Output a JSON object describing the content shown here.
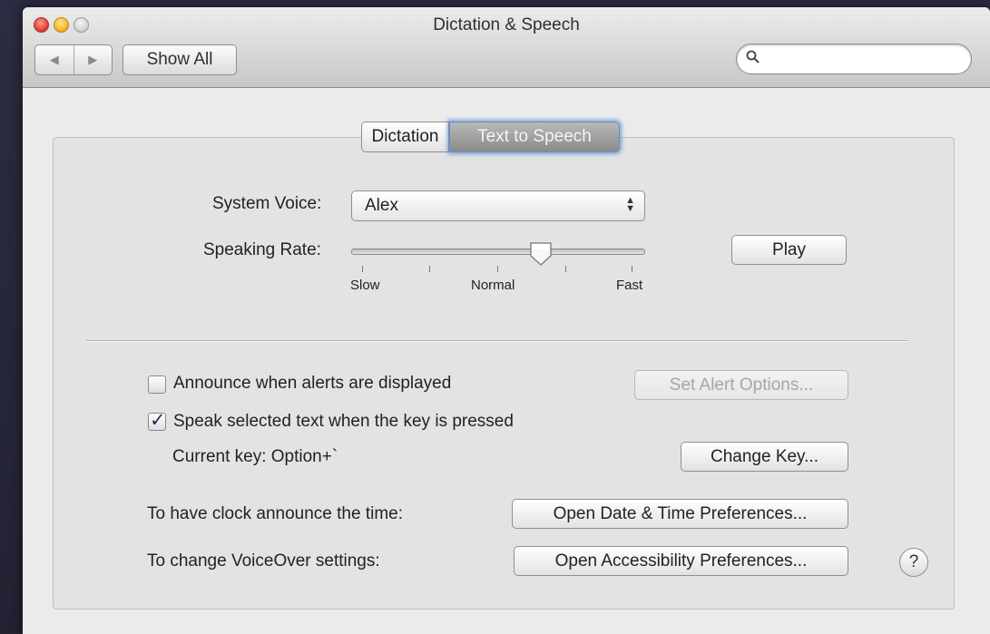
{
  "window": {
    "title": "Dictation & Speech",
    "show_all_label": "Show All",
    "nav_back": "◀",
    "nav_forward": "▶",
    "search_placeholder": ""
  },
  "tabs": [
    {
      "label": "Dictation",
      "active": false
    },
    {
      "label": "Text to Speech",
      "active": true
    }
  ],
  "voice": {
    "label": "System Voice:",
    "value": "Alex"
  },
  "rate": {
    "label": "Speaking Rate:",
    "value_fraction": 0.65,
    "tick_slow": "Slow",
    "tick_normal": "Normal",
    "tick_fast": "Fast",
    "play_label": "Play"
  },
  "alerts": {
    "label": "Announce when alerts are displayed",
    "checked": false,
    "options_label": "Set Alert Options..."
  },
  "speak_selected": {
    "label": "Speak selected text when the key is pressed",
    "checked": true,
    "current_key": "Current key: Option+`",
    "change_key_label": "Change Key..."
  },
  "clock": {
    "label": "To have clock announce the time:",
    "button": "Open Date & Time Preferences..."
  },
  "voiceover": {
    "label": "To change VoiceOver settings:",
    "button": "Open Accessibility Preferences..."
  },
  "help_label": "?"
}
